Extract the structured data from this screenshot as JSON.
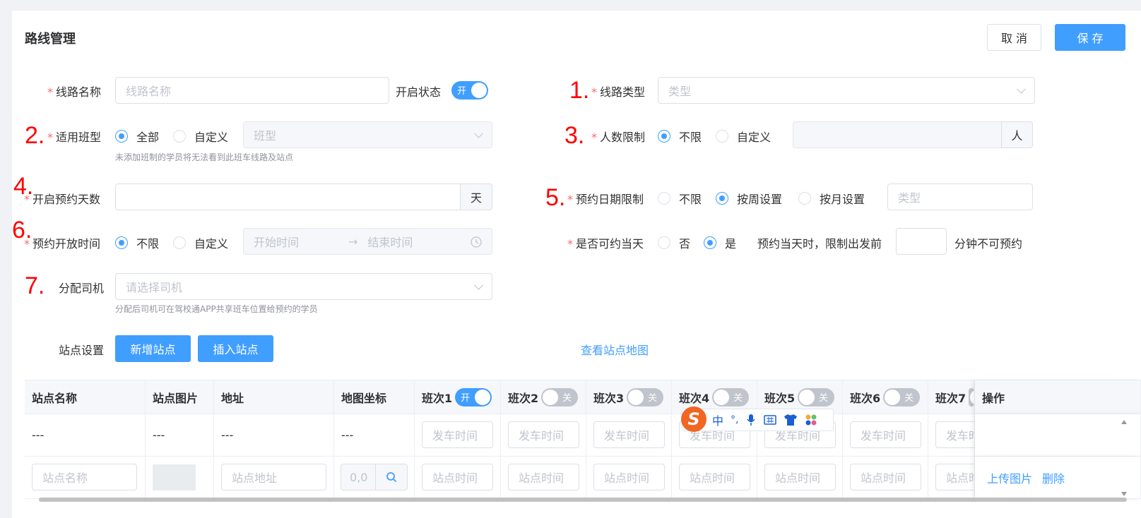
{
  "page": {
    "title": "路线管理"
  },
  "header": {
    "cancel_label": "取 消",
    "save_label": "保 存"
  },
  "markers": [
    "1.",
    "2.",
    "3.",
    "4.",
    "5.",
    "6.",
    "7."
  ],
  "form": {
    "route_name": {
      "label": "线路名称",
      "placeholder": "线路名称"
    },
    "status": {
      "label": "开启状态",
      "switch_text": "开"
    },
    "route_type": {
      "label": "线路类型",
      "placeholder": "类型"
    },
    "class_type": {
      "label": "适用班型",
      "option_all": "全部",
      "option_custom": "自定义",
      "placeholder": "班型",
      "hint": "未添加班制的学员将无法看到此班车线路及站点"
    },
    "people_limit": {
      "label": "人数限制",
      "option_unlimited": "不限",
      "option_custom": "自定义",
      "unit": "人"
    },
    "booking_days": {
      "label": "开启预约天数",
      "unit": "天"
    },
    "date_limit": {
      "label": "预约日期限制",
      "option_unlimited": "不限",
      "option_weekly": "按周设置",
      "option_monthly": "按月设置",
      "placeholder": "类型"
    },
    "open_time": {
      "label": "预约开放时间",
      "option_unlimited": "不限",
      "option_custom": "自定义",
      "start_placeholder": "开始时间",
      "end_placeholder": "结束时间",
      "arrow": "→"
    },
    "same_day": {
      "label": "是否可约当天",
      "option_no": "否",
      "option_yes": "是",
      "prefix": "预约当天时，限制出发前",
      "suffix": "分钟不可预约"
    },
    "driver": {
      "label": "分配司机",
      "placeholder": "请选择司机",
      "hint": "分配后司机可在驾校通APP共享班车位置给预约的学员"
    },
    "stations": {
      "label": "站点设置",
      "add_label": "新增站点",
      "insert_label": "插入站点",
      "map_link": "查看站点地图"
    }
  },
  "table": {
    "headers": [
      "站点名称",
      "站点图片",
      "地址",
      "地图坐标"
    ],
    "shifts": [
      {
        "label": "班次1",
        "switch": "开",
        "on": true
      },
      {
        "label": "班次2",
        "switch": "关",
        "on": false
      },
      {
        "label": "班次3",
        "switch": "关",
        "on": false
      },
      {
        "label": "班次4",
        "switch": "关",
        "on": false
      },
      {
        "label": "班次5",
        "switch": "关",
        "on": false
      },
      {
        "label": "班次6",
        "switch": "关",
        "on": false
      },
      {
        "label": "班次7",
        "switch": "",
        "on": false
      }
    ],
    "ops_header": "操作",
    "row1": {
      "dash": "---",
      "depart_placeholder": "发车时间"
    },
    "row2": {
      "name_placeholder": "站点名称",
      "address_placeholder": "站点地址",
      "coord_placeholder": "0,0",
      "station_time_placeholder": "站点时间",
      "upload_label": "上传图片",
      "delete_label": "删除"
    }
  },
  "ime": {
    "logo": "S",
    "chars": [
      "中",
      "°,"
    ]
  }
}
